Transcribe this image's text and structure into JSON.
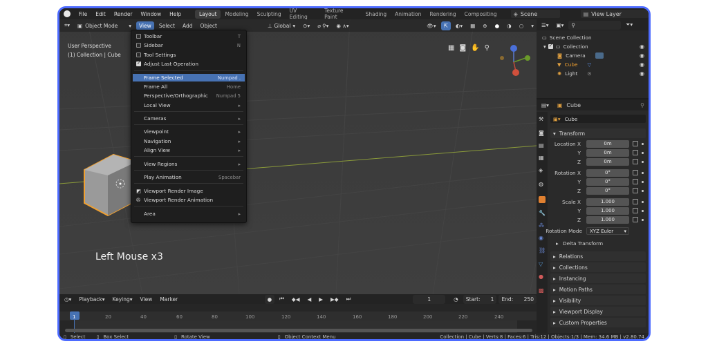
{
  "topbar": {
    "menus": [
      "File",
      "Edit",
      "Render",
      "Window",
      "Help"
    ],
    "workspaces": [
      {
        "label": "Layout",
        "active": true
      },
      {
        "label": "Modeling",
        "active": false
      },
      {
        "label": "Sculpting",
        "active": false
      },
      {
        "label": "UV Editing",
        "active": false
      },
      {
        "label": "Texture Paint",
        "active": false
      },
      {
        "label": "Shading",
        "active": false
      },
      {
        "label": "Animation",
        "active": false
      },
      {
        "label": "Rendering",
        "active": false
      },
      {
        "label": "Compositing",
        "active": false
      }
    ],
    "scene": "Scene",
    "view_layer": "View Layer"
  },
  "viewport": {
    "mode": "Object Mode",
    "menus": [
      "View",
      "Select",
      "Add",
      "Object"
    ],
    "transform_orientation": "Global",
    "overlay_title": "User Perspective",
    "overlay_subtitle": "(1) Collection | Cube",
    "caption": "Left Mouse x3"
  },
  "view_menu": [
    {
      "label": "Toolbar",
      "shortcut": "T",
      "check": "off"
    },
    {
      "label": "Sidebar",
      "shortcut": "N",
      "check": "off"
    },
    {
      "label": "Tool Settings",
      "shortcut": "",
      "check": "off"
    },
    {
      "label": "Adjust Last Operation",
      "shortcut": "",
      "check": "on"
    },
    {
      "label": "Frame Selected",
      "shortcut": "Numpad .",
      "highlight": true
    },
    {
      "label": "Frame All",
      "shortcut": "Home"
    },
    {
      "label": "Perspective/Orthographic",
      "shortcut": "Numpad 5"
    },
    {
      "label": "Local View",
      "shortcut": "▸"
    },
    {
      "label": "Cameras",
      "shortcut": "▸"
    },
    {
      "label": "Viewpoint",
      "shortcut": "▸"
    },
    {
      "label": "Navigation",
      "shortcut": "▸"
    },
    {
      "label": "Align View",
      "shortcut": "▸"
    },
    {
      "label": "View Regions",
      "shortcut": "▸"
    },
    {
      "label": "Play Animation",
      "shortcut": "Spacebar"
    },
    {
      "label": "Viewport Render Image",
      "shortcut": ""
    },
    {
      "label": "Viewport Render Animation",
      "shortcut": ""
    },
    {
      "label": "Area",
      "shortcut": "▸"
    }
  ],
  "timeline": {
    "menus": [
      "Playback",
      "Keying",
      "View",
      "Marker"
    ],
    "current_frame": "1",
    "start_label": "Start:",
    "start": "1",
    "end_label": "End:",
    "end": "250",
    "ticks": [
      "1",
      "20",
      "40",
      "60",
      "80",
      "100",
      "120",
      "140",
      "160",
      "180",
      "200",
      "220",
      "240"
    ]
  },
  "statusbar": {
    "select": "Select",
    "box_select": "Box Select",
    "rotate_view": "Rotate View",
    "context_menu": "Object Context Menu",
    "stats": "Collection | Cube | Verts:8 | Faces:6 | Tris:12 | Objects:1/3 | Mem: 34.6 MB | v2.80.74"
  },
  "outliner": {
    "root": "Scene Collection",
    "collection": "Collection",
    "items": [
      "Camera",
      "Cube",
      "Light"
    ]
  },
  "properties": {
    "object_name": "Cube",
    "datablock": "Cube",
    "transform_title": "Transform",
    "location_label": "Location X",
    "rotation_label": "Rotation X",
    "scale_label": "Scale X",
    "y_label": "Y",
    "z_label": "Z",
    "location": [
      "0m",
      "0m",
      "0m"
    ],
    "rotation": [
      "0°",
      "0°",
      "0°"
    ],
    "scale": [
      "1.000",
      "1.000",
      "1.000"
    ],
    "rotation_mode_label": "Rotation Mode",
    "rotation_mode": "XYZ Euler",
    "delta_transform": "Delta Transform",
    "panels": [
      "Relations",
      "Collections",
      "Instancing",
      "Motion Paths",
      "Visibility",
      "Viewport Display",
      "Custom Properties"
    ]
  },
  "colors": {
    "accent": "#4772b3",
    "frame_border": "#4d6bff",
    "selection_orange": "#f0a030"
  }
}
